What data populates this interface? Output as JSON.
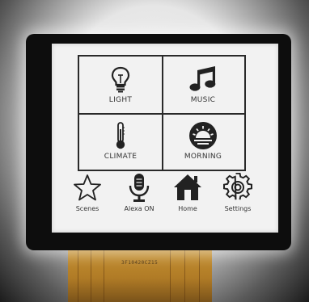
{
  "tiles": [
    {
      "label": "LIGHT",
      "icon": "lightbulb-icon"
    },
    {
      "label": "MUSIC",
      "icon": "music-note-icon"
    },
    {
      "label": "CLIMATE",
      "icon": "thermometer-icon"
    },
    {
      "label": "MORNING",
      "icon": "sunrise-icon"
    }
  ],
  "bottom_bar": [
    {
      "label": "Scenes",
      "icon": "star-icon"
    },
    {
      "label": "Alexa ON",
      "icon": "microphone-icon"
    },
    {
      "label": "Home",
      "icon": "home-icon"
    },
    {
      "label": "Settings",
      "icon": "gear-icon"
    }
  ],
  "ribbon_print": "3F10420CZ15"
}
